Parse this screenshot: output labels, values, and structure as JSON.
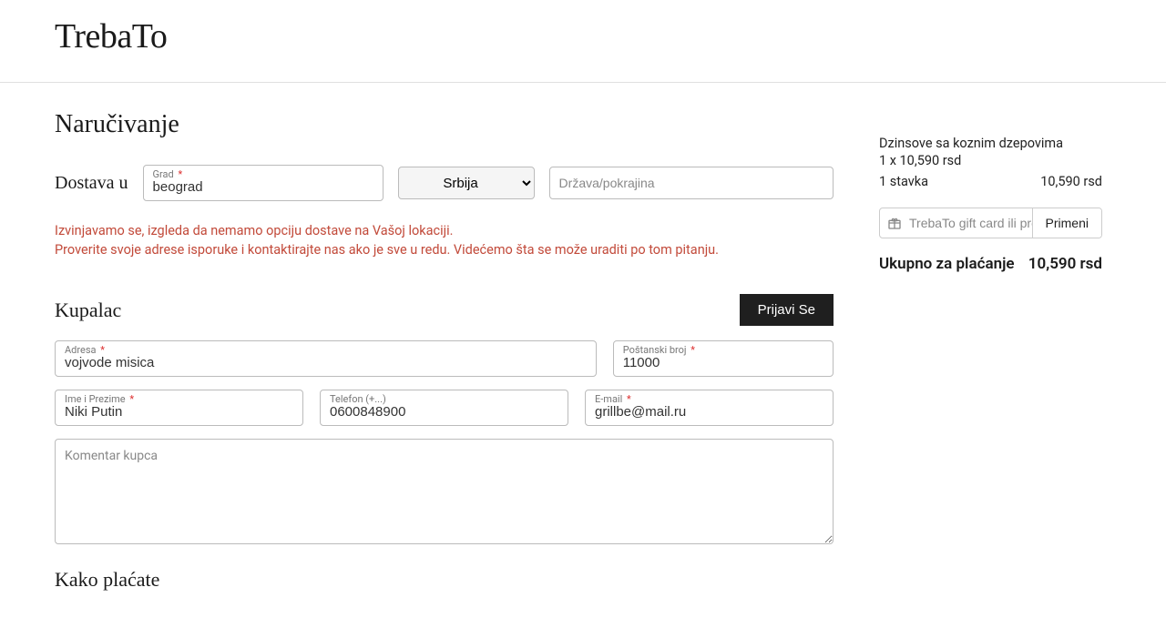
{
  "brand": "TrebaTo",
  "page_title": "Naručivanje",
  "delivery": {
    "label": "Dostava u",
    "city_label": "Grad",
    "city_value": "beograd",
    "country_value": "Srbija",
    "region_placeholder": "Država/pokrajina"
  },
  "error": {
    "line1": "Izvinjavamo se, izgleda da nemamo opciju dostave na Vašoj lokaciji.",
    "line2": "Proverite svoje adrese isporuke i kontaktirajte nas ako je sve u redu. Videćemo šta se može uraditi po tom pitanju."
  },
  "customer": {
    "heading": "Kupalac",
    "login_label": "Prijavi Se",
    "address_label": "Adresa",
    "address_value": "vojvode misica",
    "zip_label": "Poštanski broj",
    "zip_value": "11000",
    "name_label": "Ime i Prezime",
    "name_value": "Niki Putin",
    "phone_label": "Telefon (+...)",
    "phone_value": "0600848900",
    "email_label": "E-mail",
    "email_value": "grillbe@mail.ru",
    "comment_placeholder": "Komentar kupca"
  },
  "payment_heading": "Kako plaćate",
  "cart": {
    "item_name": "Dzinsove sa koznim dzepovima",
    "item_qty": "1 x 10,590 rsd",
    "count_label": "1 stavka",
    "subtotal": "10,590 rsd",
    "gift_placeholder": "TrebaTo gift card ili promo kod",
    "gift_apply": "Primeni",
    "total_label": "Ukupno za plaćanje",
    "total_value": "10,590 rsd"
  }
}
